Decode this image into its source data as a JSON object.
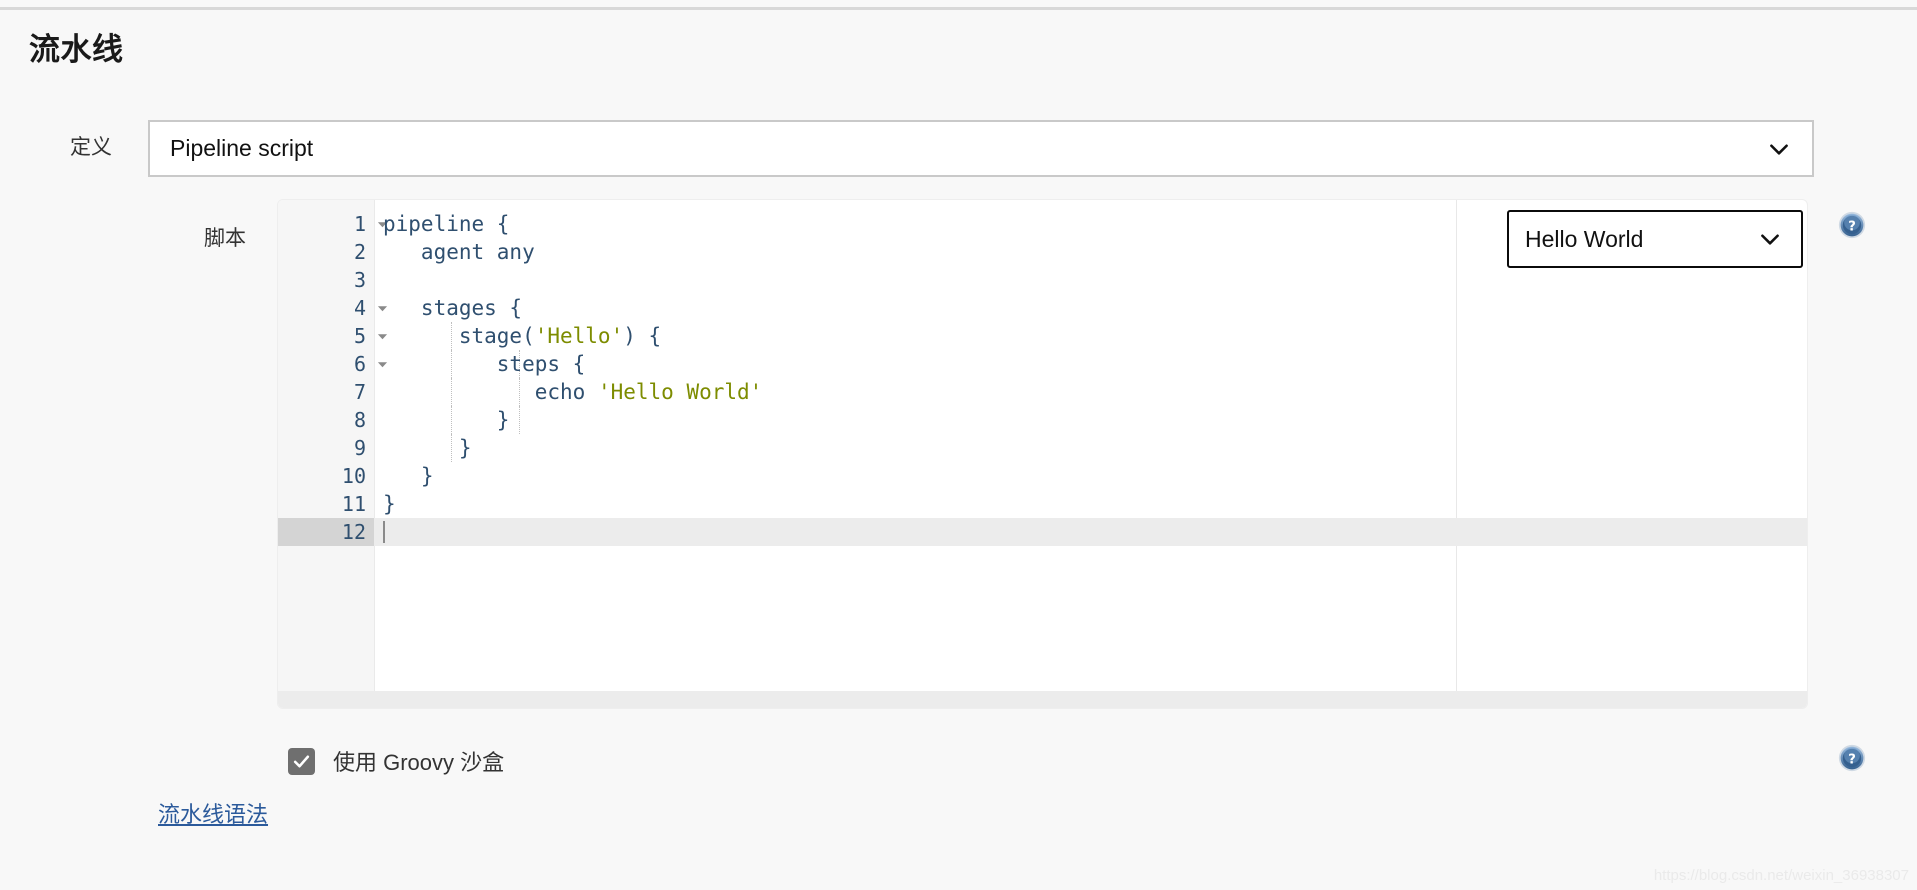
{
  "page": {
    "section_title": "流水线",
    "watermark": "https://blog.csdn.net/weixin_36938307"
  },
  "definition": {
    "label": "定义",
    "selected": "Pipeline script",
    "chevron_icon": "chevron-down-icon"
  },
  "script": {
    "label": "脚本",
    "help_icon": "help-circle-icon",
    "sample_select": {
      "selected": "Hello World",
      "chevron_icon": "chevron-down-icon"
    },
    "editor": {
      "active_line": 12,
      "total_lines": 12,
      "lines": [
        {
          "n": "1",
          "fold": true,
          "indent_guides": [],
          "segments": [
            {
              "t": "pipeline {",
              "c": "plain"
            }
          ]
        },
        {
          "n": "2",
          "fold": false,
          "indent_guides": [],
          "segments": [
            {
              "t": "   agent any",
              "c": "plain"
            }
          ]
        },
        {
          "n": "3",
          "fold": false,
          "indent_guides": [],
          "segments": [
            {
              "t": "",
              "c": "plain"
            }
          ]
        },
        {
          "n": "4",
          "fold": true,
          "indent_guides": [],
          "segments": [
            {
              "t": "   stages {",
              "c": "plain"
            }
          ]
        },
        {
          "n": "5",
          "fold": true,
          "indent_guides": [
            68
          ],
          "segments": [
            {
              "t": "      stage(",
              "c": "plain"
            },
            {
              "t": "'Hello'",
              "c": "str"
            },
            {
              "t": ") {",
              "c": "plain"
            }
          ]
        },
        {
          "n": "6",
          "fold": true,
          "indent_guides": [
            68,
            136
          ],
          "segments": [
            {
              "t": "         steps {",
              "c": "plain"
            }
          ]
        },
        {
          "n": "7",
          "fold": false,
          "indent_guides": [
            68,
            136
          ],
          "segments": [
            {
              "t": "            echo ",
              "c": "plain"
            },
            {
              "t": "'Hello World'",
              "c": "str"
            }
          ]
        },
        {
          "n": "8",
          "fold": false,
          "indent_guides": [
            68,
            136
          ],
          "segments": [
            {
              "t": "         }",
              "c": "plain"
            }
          ]
        },
        {
          "n": "9",
          "fold": false,
          "indent_guides": [
            68
          ],
          "segments": [
            {
              "t": "      }",
              "c": "plain"
            }
          ]
        },
        {
          "n": "10",
          "fold": false,
          "indent_guides": [],
          "segments": [
            {
              "t": "   }",
              "c": "plain"
            }
          ]
        },
        {
          "n": "11",
          "fold": false,
          "indent_guides": [],
          "segments": [
            {
              "t": "}",
              "c": "plain"
            }
          ]
        },
        {
          "n": "12",
          "fold": false,
          "indent_guides": [],
          "segments": [
            {
              "t": "",
              "c": "plain"
            }
          ]
        }
      ]
    }
  },
  "sandbox": {
    "checked": true,
    "label": "使用 Groovy 沙盒",
    "check_icon": "check-icon",
    "help_icon": "help-circle-icon"
  },
  "links": {
    "pipeline_syntax": "流水线语法"
  },
  "colors": {
    "link": "#2b5a9b",
    "string_literal": "#7d8c00",
    "code_text": "#2f4f6f",
    "active_line_gutter": "#d4d4d4",
    "active_line_body": "#ececec",
    "page_background": "#f8f8f8",
    "checkbox_fill": "#6f6f6f",
    "help_icon_blue": "#3f6fa8"
  }
}
